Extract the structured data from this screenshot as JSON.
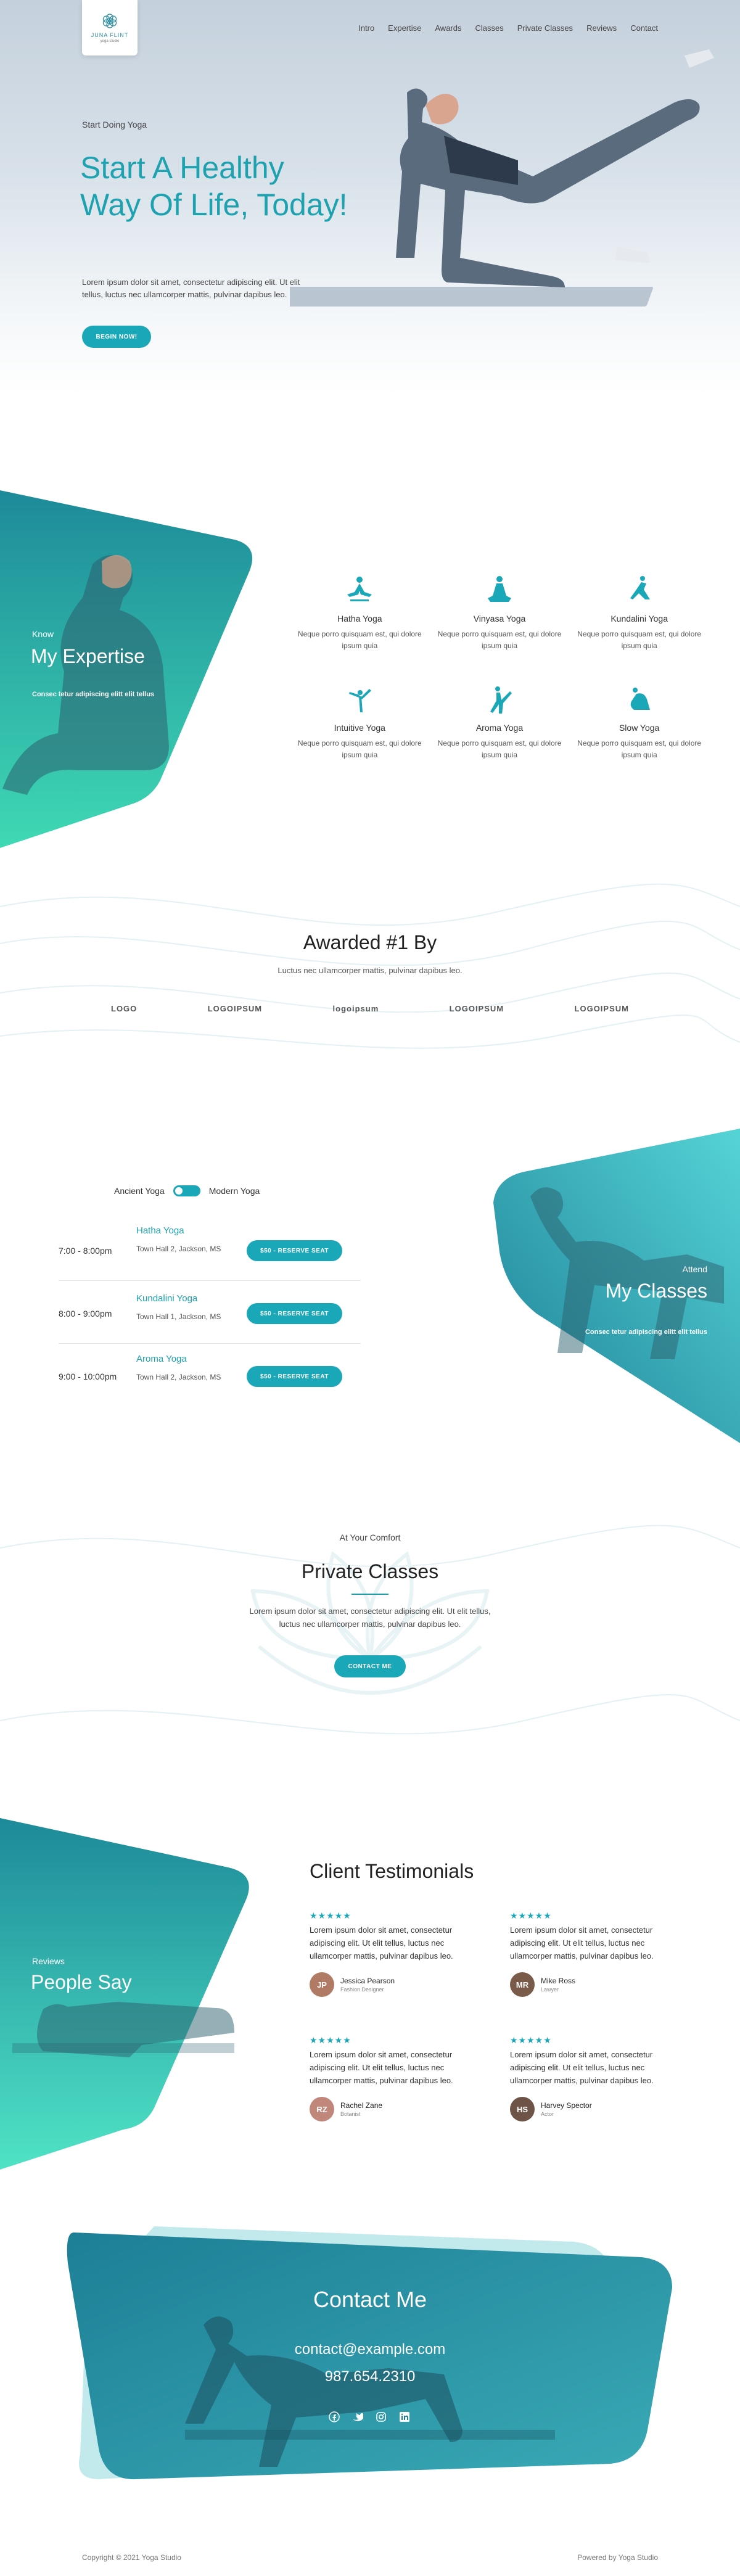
{
  "brand": {
    "name": "JUNA FLINT",
    "tagline": "yoga studio"
  },
  "nav": [
    "Intro",
    "Expertise",
    "Awards",
    "Classes",
    "Private Classes",
    "Reviews",
    "Contact"
  ],
  "hero": {
    "kicker": "Start Doing Yoga",
    "title": "Start A Healthy Way Of Life, Today!",
    "text": "Lorem ipsum dolor sit amet, consectetur adipiscing elit. Ut elit tellus, luctus nec ullamcorper mattis, pulvinar dapibus leo.",
    "button": "BEGIN NOW!"
  },
  "expertise": {
    "kicker": "Know",
    "title": "My Expertise",
    "text": "Consec tetur adipiscing elitt elit tellus",
    "items": [
      {
        "name": "Hatha Yoga",
        "desc": "Neque porro quisquam est, qui dolore ipsum quia"
      },
      {
        "name": "Vinyasa Yoga",
        "desc": "Neque porro quisquam est, qui dolore ipsum quia"
      },
      {
        "name": "Kundalini Yoga",
        "desc": "Neque porro quisquam est, qui dolore ipsum quia"
      },
      {
        "name": "Intuitive Yoga",
        "desc": "Neque porro quisquam est, qui dolore ipsum quia"
      },
      {
        "name": "Aroma Yoga",
        "desc": "Neque porro quisquam est, qui dolore ipsum quia"
      },
      {
        "name": "Slow Yoga",
        "desc": "Neque porro quisquam est, qui dolore ipsum quia"
      }
    ]
  },
  "awards": {
    "title": "Awarded #1 By",
    "text": "Luctus nec ullamcorper mattis, pulvinar dapibus leo.",
    "logos": [
      "LOGO",
      "LOGOIPSUM",
      "logoipsum",
      "LOGOIPSUM",
      "LOGOIPSUM"
    ]
  },
  "classes": {
    "toggle_left": "Ancient Yoga",
    "toggle_right": "Modern Yoga",
    "rows": [
      {
        "time": "7:00 - 8:00pm",
        "name": "Hatha Yoga",
        "location": "Town Hall 2, Jackson, MS",
        "button": "$50 - RESERVE SEAT"
      },
      {
        "time": "8:00 - 9:00pm",
        "name": "Kundalini Yoga",
        "location": "Town Hall 1, Jackson, MS",
        "button": "$50 - RESERVE SEAT"
      },
      {
        "time": "9:00 - 10:00pm",
        "name": "Aroma Yoga",
        "location": "Town Hall 2, Jackson, MS",
        "button": "$50 - RESERVE SEAT"
      }
    ],
    "kicker": "Attend",
    "title": "My Classes",
    "text": "Consec tetur adipiscing elitt elit tellus"
  },
  "private": {
    "kicker": "At Your Comfort",
    "title": "Private Classes",
    "text": "Lorem ipsum dolor sit amet, consectetur adipiscing elit. Ut elit tellus, luctus nec ullamcorper mattis, pulvinar dapibus leo.",
    "button": "CONTACT ME"
  },
  "reviews": {
    "kicker": "Reviews",
    "title": "People Say",
    "heading": "Client Testimonials",
    "items": [
      {
        "stars": "★★★★★",
        "quote": "Lorem ipsum dolor sit amet, consectetur adipiscing elit. Ut elit tellus, luctus nec ullamcorper mattis, pulvinar dapibus leo.",
        "name": "Jessica Pearson",
        "role": "Fashion Designer",
        "initials": "JP"
      },
      {
        "stars": "★★★★★",
        "quote": "Lorem ipsum dolor sit amet, consectetur adipiscing elit. Ut elit tellus, luctus nec ullamcorper mattis, pulvinar dapibus leo.",
        "name": "Mike Ross",
        "role": "Lawyer",
        "initials": "MR"
      },
      {
        "stars": "★★★★★",
        "quote": "Lorem ipsum dolor sit amet, consectetur adipiscing elit. Ut elit tellus, luctus nec ullamcorper mattis, pulvinar dapibus leo.",
        "name": "Rachel Zane",
        "role": "Botanist",
        "initials": "RZ"
      },
      {
        "stars": "★★★★★",
        "quote": "Lorem ipsum dolor sit amet, consectetur adipiscing elit. Ut elit tellus, luctus nec ullamcorper mattis, pulvinar dapibus leo.",
        "name": "Harvey Spector",
        "role": "Actor",
        "initials": "HS"
      }
    ]
  },
  "contact": {
    "title": "Contact Me",
    "email": "contact@example.com",
    "phone": "987.654.2310",
    "socials": [
      "facebook-icon",
      "twitter-icon",
      "instagram-icon",
      "linkedin-icon"
    ]
  },
  "footer": {
    "copyright": "Copyright © 2021 Yoga Studio",
    "powered": "Powered by Yoga Studio"
  },
  "colors": {
    "accent": "#1aa8b8",
    "teal_dark": "#1d7f96",
    "teal_light": "#4fe0c8"
  }
}
